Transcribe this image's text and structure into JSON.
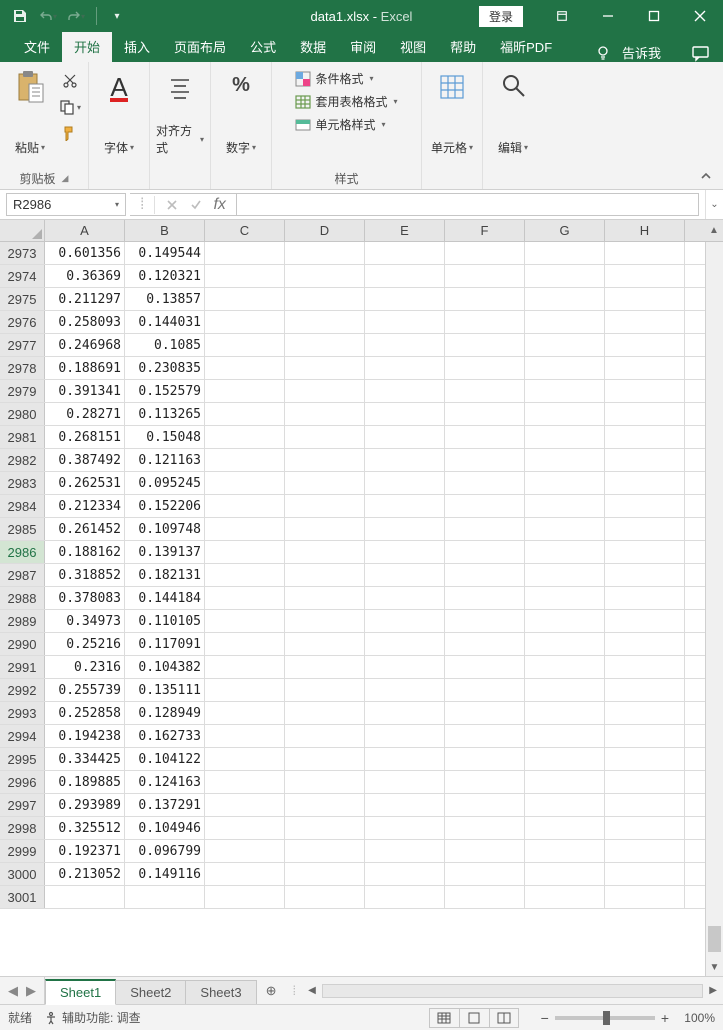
{
  "title": {
    "file": "data1.xlsx",
    "app": "Excel",
    "sep": " - "
  },
  "login": "登录",
  "menu": [
    "文件",
    "开始",
    "插入",
    "页面布局",
    "公式",
    "数据",
    "审阅",
    "视图",
    "帮助",
    "福昕PDF"
  ],
  "activeMenu": 1,
  "tellMe": "告诉我",
  "ribbon": {
    "clipboard": {
      "paste": "粘贴",
      "label": "剪贴板"
    },
    "font": {
      "btn": "字体"
    },
    "align": {
      "btn": "对齐方式"
    },
    "number": {
      "btn": "数字"
    },
    "styles": {
      "cond": "条件格式",
      "table": "套用表格格式",
      "cell": "单元格样式",
      "label": "样式"
    },
    "cells": {
      "btn": "单元格"
    },
    "editing": {
      "btn": "编辑"
    }
  },
  "nameBox": "R2986",
  "fx": "fx",
  "columns": [
    "A",
    "B",
    "C",
    "D",
    "E",
    "F",
    "G",
    "H"
  ],
  "rows": [
    {
      "r": "2973",
      "a": "0.601356",
      "b": "0.149544"
    },
    {
      "r": "2974",
      "a": "0.36369",
      "b": "0.120321"
    },
    {
      "r": "2975",
      "a": "0.211297",
      "b": "0.13857"
    },
    {
      "r": "2976",
      "a": "0.258093",
      "b": "0.144031"
    },
    {
      "r": "2977",
      "a": "0.246968",
      "b": "0.1085"
    },
    {
      "r": "2978",
      "a": "0.188691",
      "b": "0.230835"
    },
    {
      "r": "2979",
      "a": "0.391341",
      "b": "0.152579"
    },
    {
      "r": "2980",
      "a": "0.28271",
      "b": "0.113265"
    },
    {
      "r": "2981",
      "a": "0.268151",
      "b": "0.15048"
    },
    {
      "r": "2982",
      "a": "0.387492",
      "b": "0.121163"
    },
    {
      "r": "2983",
      "a": "0.262531",
      "b": "0.095245"
    },
    {
      "r": "2984",
      "a": "0.212334",
      "b": "0.152206"
    },
    {
      "r": "2985",
      "a": "0.261452",
      "b": "0.109748"
    },
    {
      "r": "2986",
      "a": "0.188162",
      "b": "0.139137"
    },
    {
      "r": "2987",
      "a": "0.318852",
      "b": "0.182131"
    },
    {
      "r": "2988",
      "a": "0.378083",
      "b": "0.144184"
    },
    {
      "r": "2989",
      "a": "0.34973",
      "b": "0.110105"
    },
    {
      "r": "2990",
      "a": "0.25216",
      "b": "0.117091"
    },
    {
      "r": "2991",
      "a": "0.2316",
      "b": "0.104382"
    },
    {
      "r": "2992",
      "a": "0.255739",
      "b": "0.135111"
    },
    {
      "r": "2993",
      "a": "0.252858",
      "b": "0.128949"
    },
    {
      "r": "2994",
      "a": "0.194238",
      "b": "0.162733"
    },
    {
      "r": "2995",
      "a": "0.334425",
      "b": "0.104122"
    },
    {
      "r": "2996",
      "a": "0.189885",
      "b": "0.124163"
    },
    {
      "r": "2997",
      "a": "0.293989",
      "b": "0.137291"
    },
    {
      "r": "2998",
      "a": "0.325512",
      "b": "0.104946"
    },
    {
      "r": "2999",
      "a": "0.192371",
      "b": "0.096799"
    },
    {
      "r": "3000",
      "a": "0.213052",
      "b": "0.149116"
    },
    {
      "r": "3001",
      "a": "",
      "b": ""
    }
  ],
  "activeRow": "2986",
  "sheets": [
    "Sheet1",
    "Sheet2",
    "Sheet3"
  ],
  "activeSheet": 0,
  "status": {
    "ready": "就绪",
    "acc": "辅助功能: 调查",
    "zoom": "100%"
  }
}
